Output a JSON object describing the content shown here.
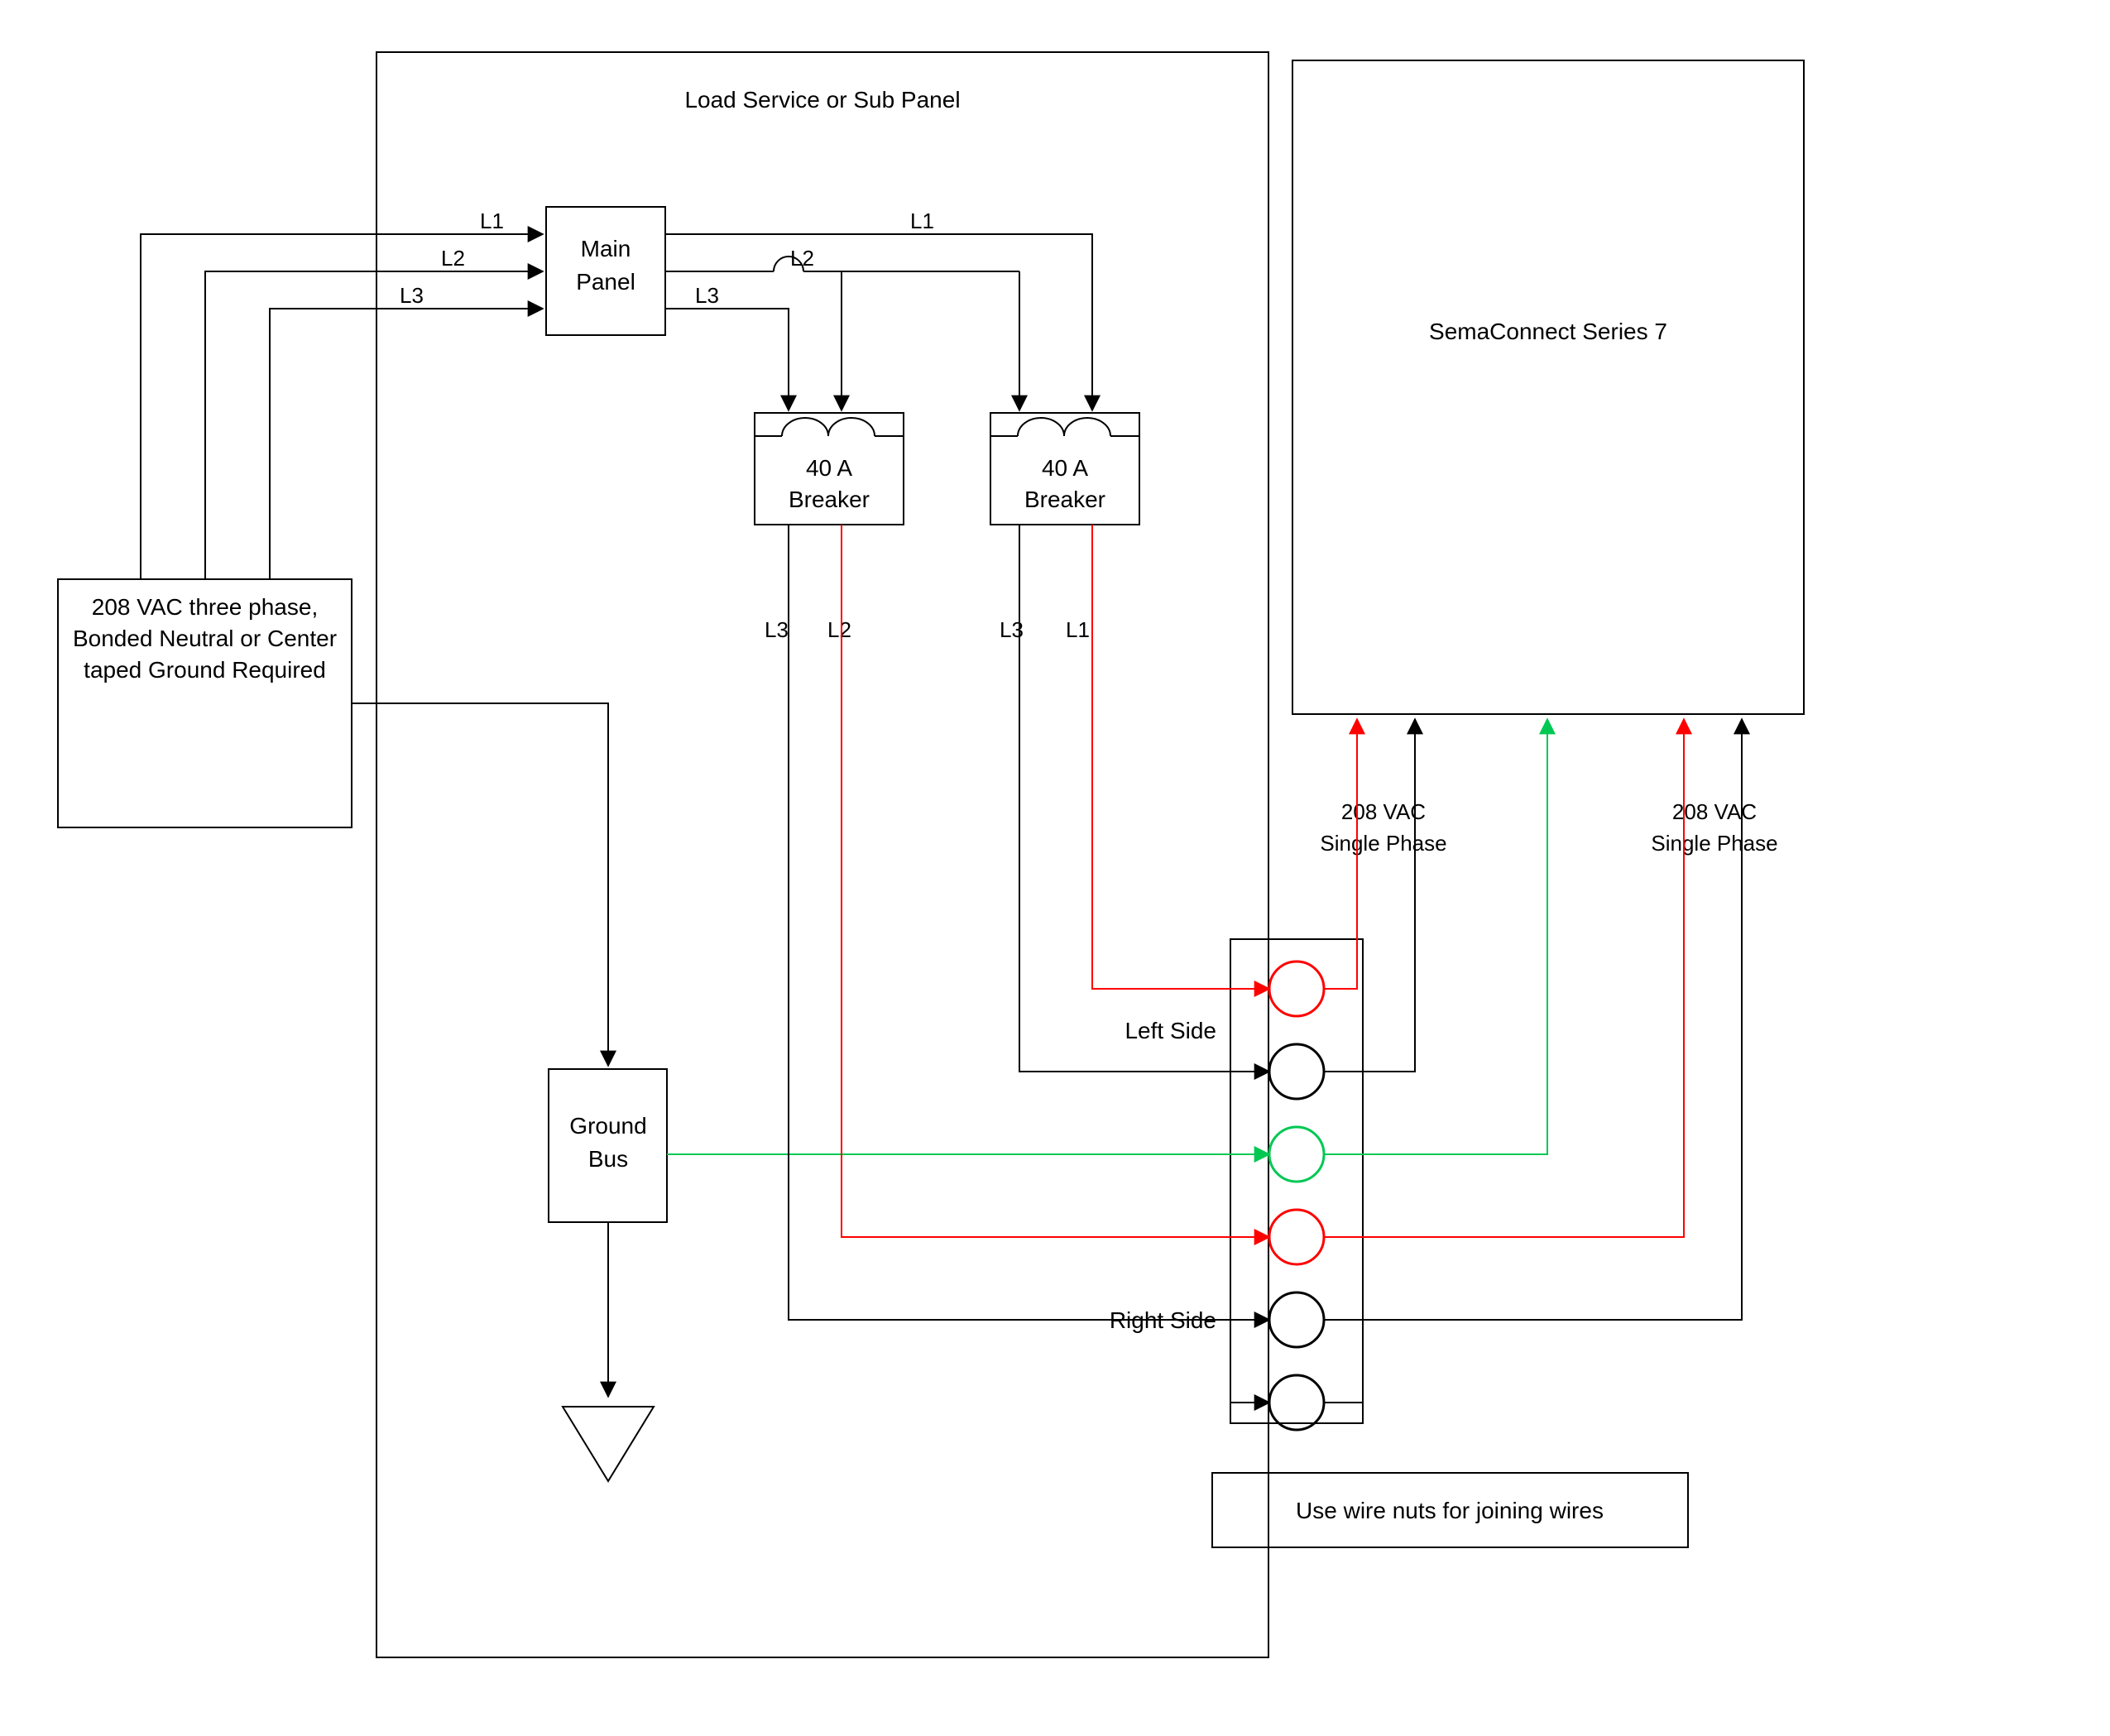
{
  "panel_title": "Load Service or Sub Panel",
  "source_box": "208 VAC three phase, Bonded Neutral or Center taped Ground Required",
  "main_panel": "Main Panel",
  "breaker": "40 A Breaker",
  "ground_bus": "Ground Bus",
  "left_side": "Left Side",
  "right_side": "Right Side",
  "wire_note": "Use wire nuts for joining wires",
  "sema_title": "SemaConnect Series 7",
  "phase_label": "208 VAC Single Phase",
  "phases": {
    "L1": "L1",
    "L2": "L2",
    "L3": "L3"
  },
  "colors": {
    "black": "#000000",
    "red": "#ff0000",
    "green": "#00c853"
  }
}
